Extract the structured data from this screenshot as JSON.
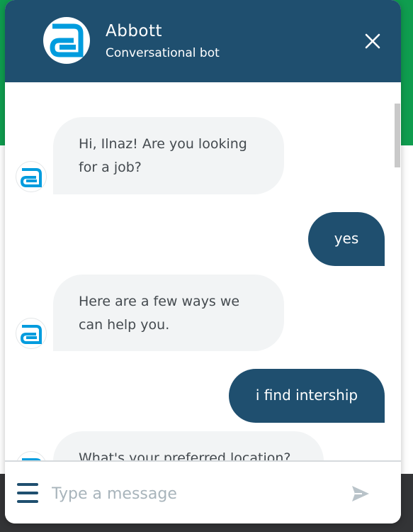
{
  "header": {
    "title": "Abbott",
    "subtitle": "Conversational bot"
  },
  "messages": [
    {
      "from": "bot",
      "text": "Hi, Ilnaz! Are you looking for a job?"
    },
    {
      "from": "user",
      "text": "yes"
    },
    {
      "from": "bot",
      "text": "Here are a few ways we can help you."
    },
    {
      "from": "user",
      "text": "i find intership"
    },
    {
      "from": "bot",
      "text": "What's your preferred location?"
    }
  ],
  "composer": {
    "placeholder": "Type a message"
  },
  "colors": {
    "brand": "#1f4f6f",
    "logo": "#009cde",
    "bot_bubble": "#f2f4f5",
    "background_page": "#0f9d4f"
  },
  "icons": {
    "logo": "abbott-logo-icon",
    "close": "close-icon",
    "menu": "hamburger-menu-icon",
    "send": "send-icon"
  }
}
